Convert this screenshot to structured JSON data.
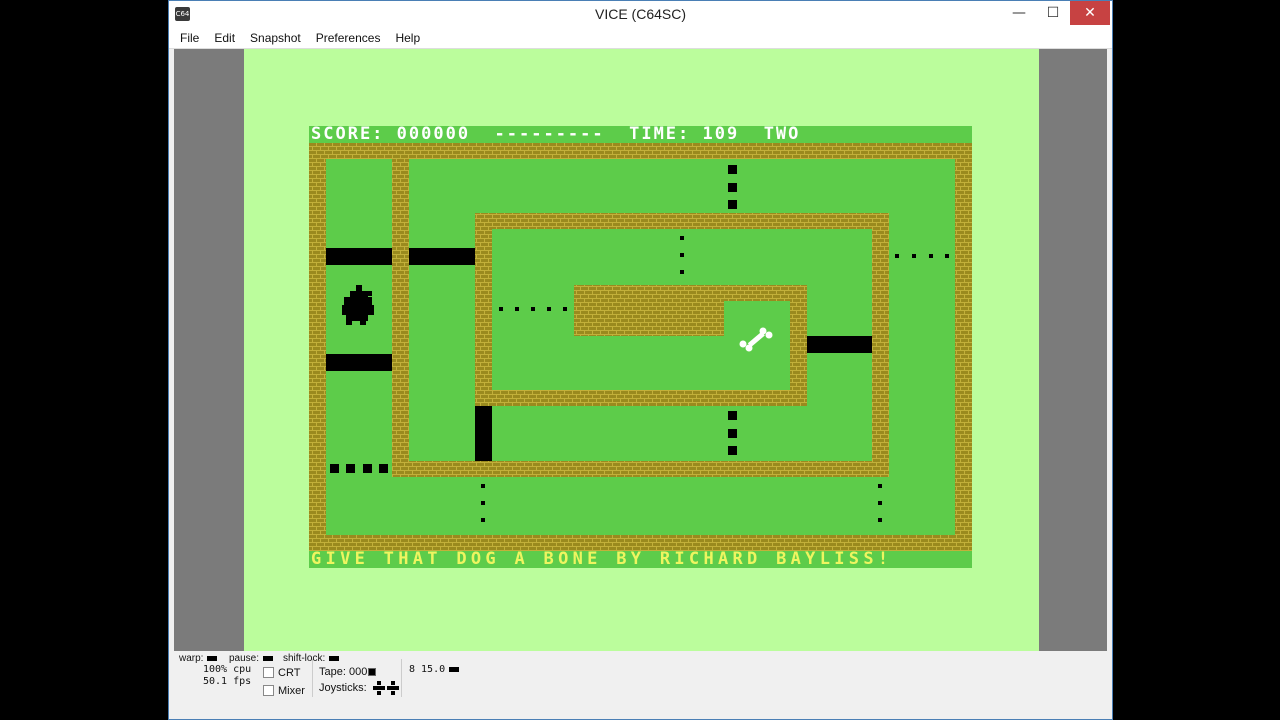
{
  "window": {
    "title": "VICE (C64SC)",
    "icon_text": "C64",
    "buttons": {
      "minimize": "—",
      "maximize": "☐",
      "close": "✕"
    }
  },
  "menu": [
    "File",
    "Edit",
    "Snapshot",
    "Preferences",
    "Help"
  ],
  "game": {
    "hud_text": "SCORE: 000000  ---------  TIME: 109  TWO",
    "bottom_text": "GIVE THAT DOG A BONE BY RICHARD BAYLISS!"
  },
  "status": {
    "warp_label": "warp:",
    "pause_label": "pause:",
    "shift_lock_label": "shift-lock:",
    "cpu": "100% cpu",
    "fps": "50.1 fps",
    "crt_label": "CRT",
    "mixer_label": "Mixer",
    "tape_label": "Tape:",
    "tape_counter": "000",
    "joysticks_label": "Joysticks:",
    "drive_text": "8 15.0"
  },
  "colors": {
    "field_green": "#5dcc4a",
    "brick": "#9a8a1e",
    "mortar": "#c2b03a",
    "border_light_green": "#bbfd9c",
    "bottom_text_yellow": "#eef560"
  }
}
